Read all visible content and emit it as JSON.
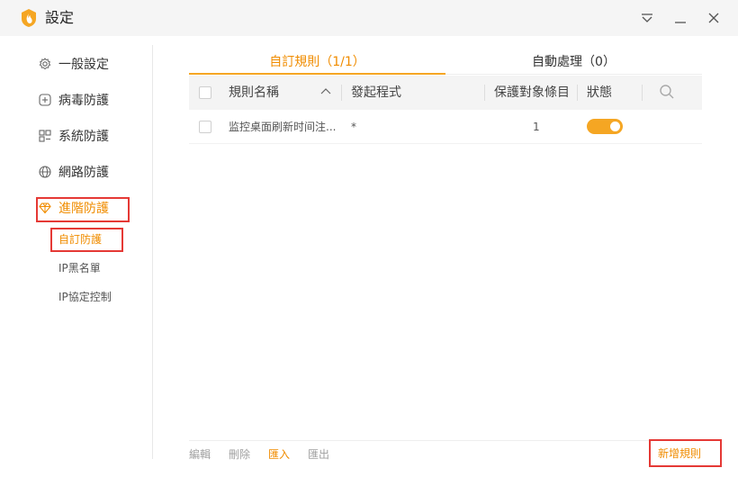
{
  "window": {
    "title": "設定",
    "controls": [
      "menu-icon",
      "minimize-icon",
      "close-icon"
    ]
  },
  "sidebar": {
    "items": [
      {
        "label": "一般設定",
        "icon": "gear-icon"
      },
      {
        "label": "病毒防護",
        "icon": "plus-square-icon"
      },
      {
        "label": "系統防護",
        "icon": "grid-icon"
      },
      {
        "label": "網路防護",
        "icon": "globe-icon"
      },
      {
        "label": "進階防護",
        "icon": "diamond-icon",
        "active": true
      }
    ],
    "sub_items": [
      {
        "label": "自訂防護",
        "active": true
      },
      {
        "label": "IP黑名單"
      },
      {
        "label": "IP協定控制"
      }
    ]
  },
  "tabs": [
    {
      "label": "自訂規則（1/1）",
      "active": true
    },
    {
      "label": "自動處理（0）"
    }
  ],
  "table": {
    "headers": [
      "規則名稱",
      "發起程式",
      "保護對象條目",
      "狀態"
    ],
    "rows": [
      {
        "name": "监控桌面刷新时间注...",
        "program": "*",
        "targets": "1",
        "enabled": true
      }
    ]
  },
  "footer": {
    "actions": [
      {
        "label": "編輯",
        "enabled": false
      },
      {
        "label": "刪除",
        "enabled": false
      },
      {
        "label": "匯入",
        "enabled": true
      },
      {
        "label": "匯出",
        "enabled": false
      }
    ],
    "add_label": "新增規則"
  },
  "colors": {
    "accent": "#f5a623",
    "accent_text": "#f08c00",
    "highlight_box": "#e53935",
    "titlebar_bg": "#f5f5f5"
  }
}
